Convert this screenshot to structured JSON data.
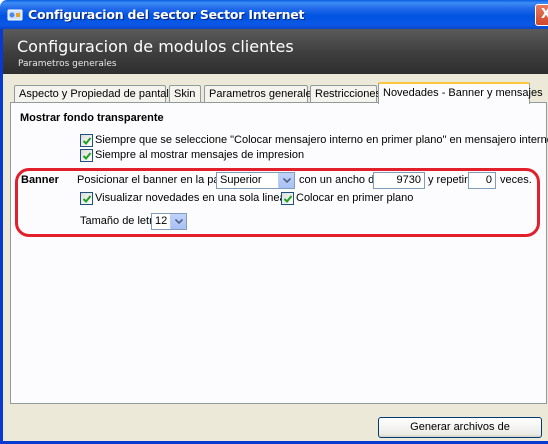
{
  "window": {
    "title": "Configuracion del sector Sector Internet",
    "icon": "app-icon",
    "close_glyph": "X"
  },
  "header": {
    "title": "Configuracion de modulos clientes",
    "subtitle": "Parametros generales"
  },
  "tabs": [
    {
      "label": "Aspecto y Propiedad de pantalla",
      "active": false
    },
    {
      "label": "Skin",
      "active": false
    },
    {
      "label": "Parametros generales",
      "active": false
    },
    {
      "label": "Restricciones",
      "active": false
    },
    {
      "label": "Novedades - Banner y mensajes",
      "active": true
    }
  ],
  "transparent_section": {
    "heading": "Mostrar fondo transparente",
    "options": [
      {
        "label": "Siempre que se seleccione \"Colocar mensajero interno en primer plano\" en mensajero interno",
        "checked": true
      },
      {
        "label": "Siempre al mostrar mensajes de impresion",
        "checked": true
      }
    ]
  },
  "banner": {
    "label": "Banner",
    "position_prefix": "Posicionar el banner en la parte",
    "position_value": "Superior",
    "width_label": "con un ancho de",
    "width_value": "9730",
    "repeat_label": "y repetir",
    "repeat_value": "0",
    "repeat_suffix": "veces.",
    "single_line_label": "Visualizar novedades en una sola linea",
    "single_line_checked": true,
    "foreground_label": "Colocar en primer plano",
    "foreground_checked": true,
    "font_size_label": "Tamaño de letra",
    "font_size_value": "12"
  },
  "footer": {
    "generate_button": "Generar archivos de actualizacion"
  },
  "colors": {
    "titlebar": "#0053e1",
    "header_bg": "#3e3e3e",
    "body_bg": "#ece9d8",
    "highlight": "#e2202b",
    "active_tab_accent": "#ffc83c"
  }
}
